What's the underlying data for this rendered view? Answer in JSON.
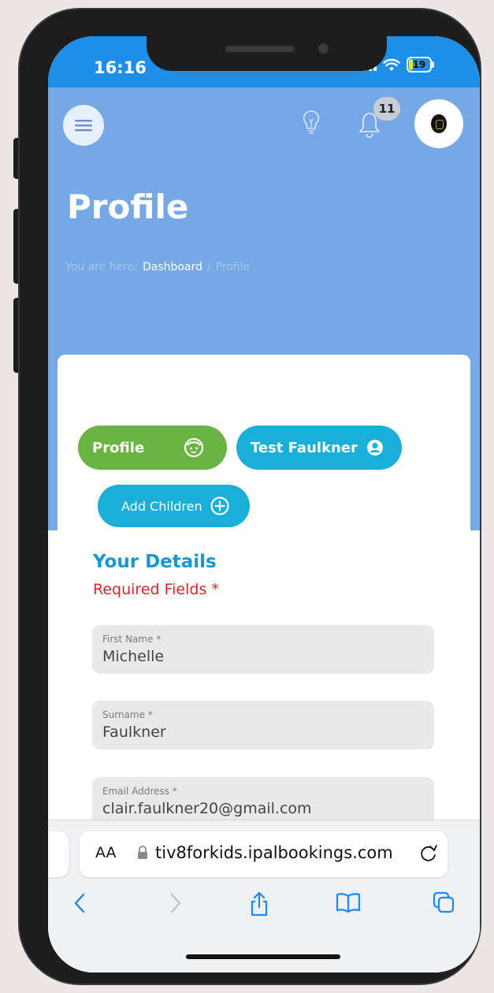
{
  "status_bar": {
    "time": "16:16",
    "battery_level": "19",
    "battery_fraction": 0.19,
    "battery_color": "#F4E214"
  },
  "header": {
    "notification_count": "11",
    "page_title": "Profile",
    "breadcrumb": {
      "prefix": "You are here:",
      "link": "Dashboard",
      "separator": "/",
      "current": "Profile"
    }
  },
  "tabs": {
    "profile_label": "Profile",
    "child_label": "Test Faulkner",
    "add_children_label": "Add Children"
  },
  "form": {
    "section_title": "Your Details",
    "required_note": "Required Fields *",
    "fields": [
      {
        "label": "First Name *",
        "value": "Michelle"
      },
      {
        "label": "Surname *",
        "value": "Faulkner"
      },
      {
        "label": "Email Address *",
        "value": "clair.faulkner20@gmail.com"
      }
    ]
  },
  "browser": {
    "text_size_label": "AA",
    "url": "tiv8forkids.ipalbookings.com"
  },
  "colors": {
    "header_bg": "#76A8E6",
    "status_bar_bg": "#1E8FE8",
    "profile_pill": "#6BB443",
    "child_pill": "#1AAFD9",
    "section_title": "#1598CF",
    "required": "#D9262B"
  },
  "icons": {
    "menu": "hamburger-icon",
    "bulb": "lightbulb-icon",
    "bell": "bell-icon",
    "profile_tab": "child-face-icon",
    "child_tab": "user-icon",
    "add": "plus-circle-icon",
    "lock": "lock-icon",
    "reload": "reload-icon",
    "back": "chevron-left-icon",
    "forward": "chevron-right-icon",
    "share": "share-icon",
    "bookmarks": "book-icon",
    "tabs": "tabs-icon"
  }
}
